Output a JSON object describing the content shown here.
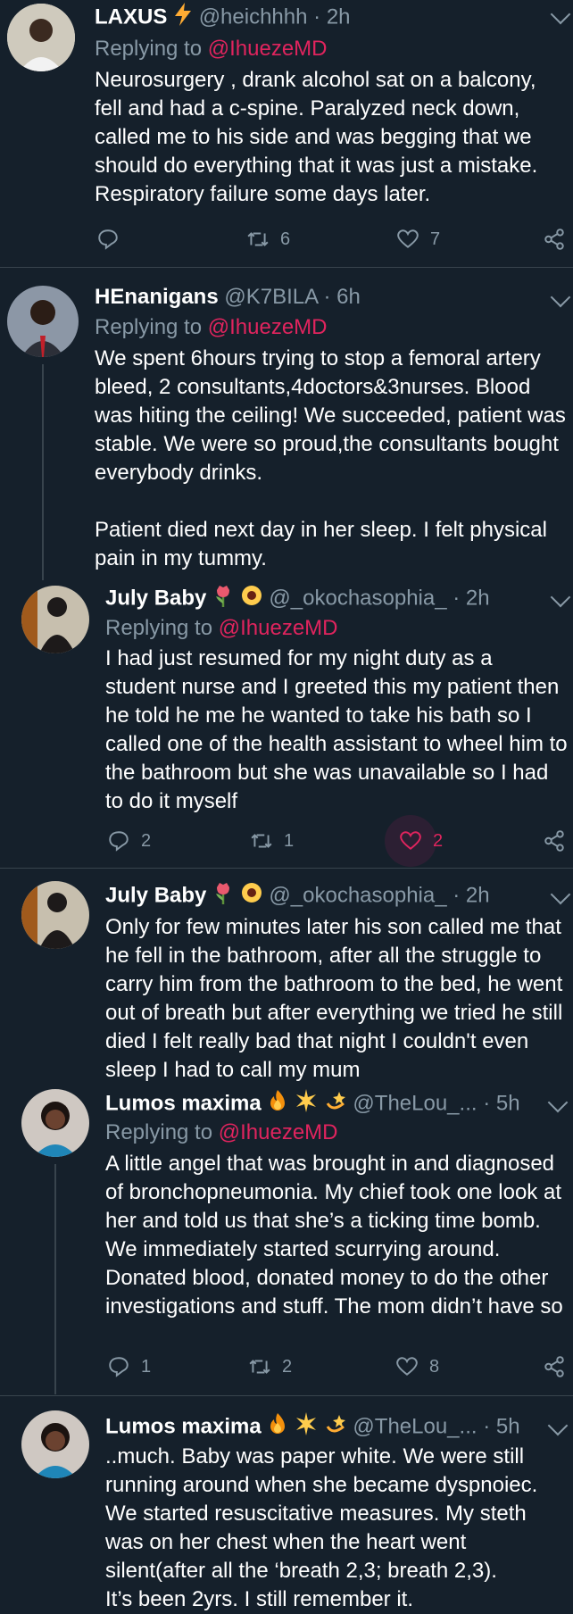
{
  "tweets": [
    {
      "name": "LAXUS",
      "handle": "@heichhhh",
      "time": "2h",
      "replying_label": "Replying to",
      "replying_to": "@IhuezeMD",
      "text": "Neurosurgery , drank alcohol sat on a balcony, fell and had a c-spine. Paralyzed neck down, called me to his side and was begging that we should do everything that it was just a mistake. Respiratory failure some days later.",
      "replies": "",
      "retweets": "6",
      "likes": "7"
    },
    {
      "name": "HEnanigans",
      "handle": "@K7BILA",
      "time": "6h",
      "replying_label": "Replying to",
      "replying_to": "@IhuezeMD",
      "text": "We spent 6hours trying to stop a femoral artery bleed, 2 consultants,4doctors&3nurses. Blood was hiting the ceiling! We succeeded, patient was stable. We were so proud,the consultants bought everybody drinks.\n\nPatient died next day in her sleep. I felt physical pain in my tummy."
    },
    {
      "name": "July Baby",
      "handle": "@_okochasophia_",
      "time": "2h",
      "replying_label": "Replying to",
      "replying_to": "@IhuezeMD",
      "text": "I had just resumed for my night duty as a student nurse and I greeted this my patient then he told he me he wanted to take his bath so I called one of the health assistant to wheel him to the bathroom but she was unavailable so I had to do it myself",
      "replies": "2",
      "retweets": "1",
      "likes": "2"
    },
    {
      "name": "July Baby",
      "handle": "@_okochasophia_",
      "time": "2h",
      "text": "Only for few minutes later his son called me that he fell in the bathroom, after all the struggle to carry him from the bathroom to the bed, he went out of breath but after everything we tried he still died I felt really bad that night I couldn't even sleep I had to call my mum"
    },
    {
      "name": "Lumos maxima",
      "handle": "@TheLou_...",
      "time": "5h",
      "replying_label": "Replying to",
      "replying_to": "@IhuezeMD",
      "text": "A little angel that was brought in and diagnosed of bronchopneumonia. My chief took one look at her and told us that she’s a ticking time bomb. We immediately started scurrying around. Donated blood, donated money to do the other investigations and stuff. The mom didn’t have so",
      "replies": "1",
      "retweets": "2",
      "likes": "8"
    },
    {
      "name": "Lumos maxima",
      "handle": "@TheLou_...",
      "time": "5h",
      "text": "..much. Baby was paper white. We were still running around when she became dyspnoiec. We started resuscitative measures. My steth was on her chest when the heart went silent(after all the ‘breath 2,3; breath 2,3).\nIt’s been 2yrs. I still remember it."
    }
  ],
  "time_separator": "·",
  "icons": {
    "reply": "reply-icon",
    "retweet": "retweet-icon",
    "like": "heart-icon",
    "share": "share-icon",
    "caret": "chevron-down-icon",
    "lightning": "lightning-emoji",
    "tulip": "tulip-emoji",
    "sunflower": "sunflower-emoji",
    "fire": "fire-emoji",
    "sparkle": "sun-emoji",
    "dizzy": "dizzy-emoji"
  },
  "colors": {
    "background": "#15202b",
    "divider": "#38444d",
    "secondary_text": "#8899a6",
    "mention": "#e0245e",
    "liked": "#e0245e"
  }
}
